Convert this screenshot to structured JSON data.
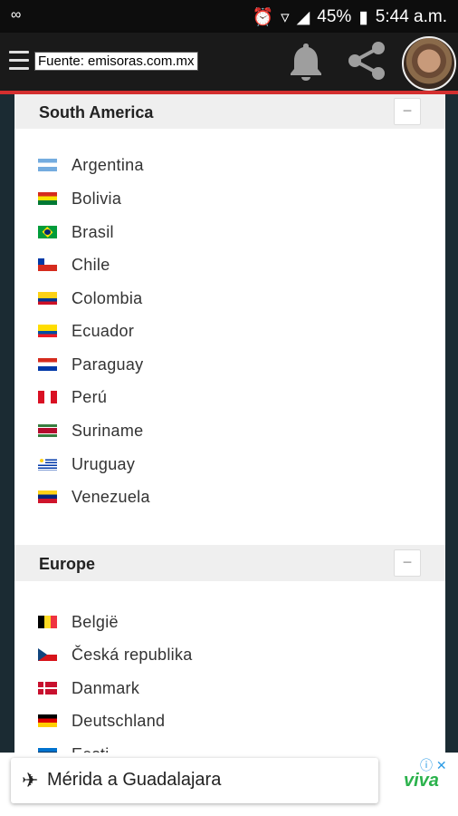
{
  "status_bar": {
    "time": "5:44 a.m.",
    "battery": "45%"
  },
  "top_bar": {
    "source_label": "Fuente: emisoras.com.mx"
  },
  "sections": [
    {
      "title": "South America",
      "collapse_symbol": "−",
      "countries": [
        "Argentina",
        "Bolivia",
        "Brasil",
        "Chile",
        "Colombia",
        "Ecuador",
        "Paraguay",
        "Perú",
        "Suriname",
        "Uruguay",
        "Venezuela"
      ]
    },
    {
      "title": "Europe",
      "collapse_symbol": "−",
      "countries": [
        "België",
        "Česká republika",
        "Danmark",
        "Deutschland",
        "Eesti"
      ]
    }
  ],
  "ad": {
    "text": "Mérida a Guadalajara",
    "brand": "viva"
  }
}
